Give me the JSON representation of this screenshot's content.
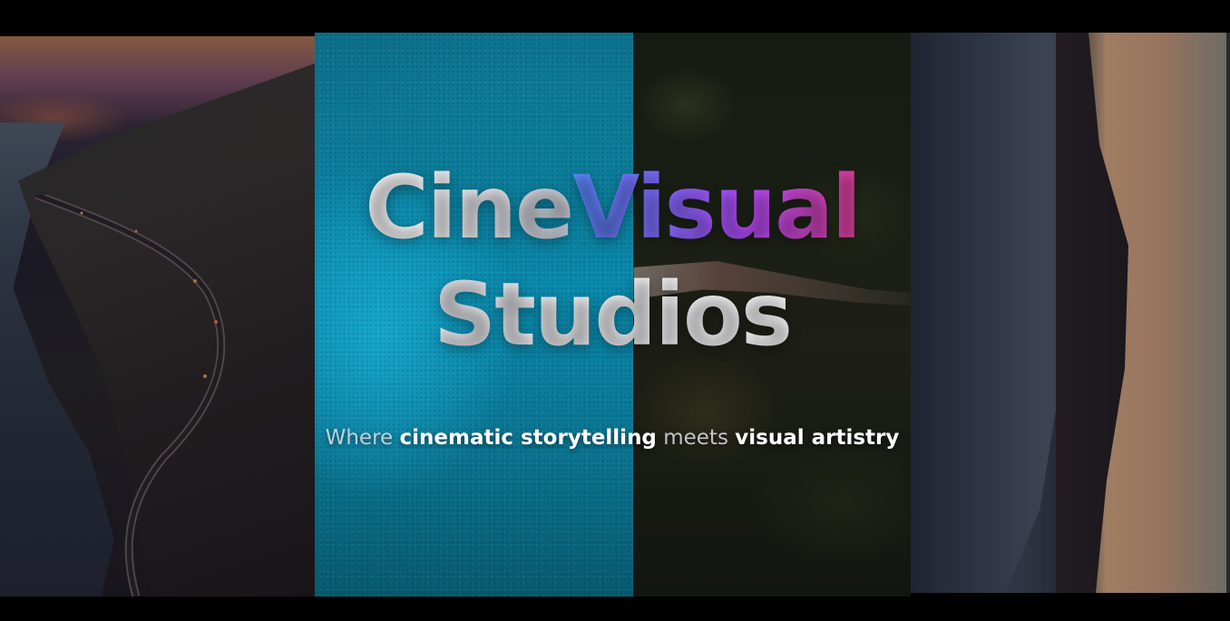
{
  "hero": {
    "title_part1": "Cine",
    "title_part2": "Visual",
    "title_line2": "Studios",
    "subtitle": {
      "w1": "Where ",
      "s1": "cinematic storytelling",
      "w2": " meets ",
      "s2": "visual artistry"
    }
  },
  "colors": {
    "visual_gradient_start": "#5a8cff",
    "visual_gradient_end": "#e5409c",
    "teal_panel": "#0a8aad"
  }
}
